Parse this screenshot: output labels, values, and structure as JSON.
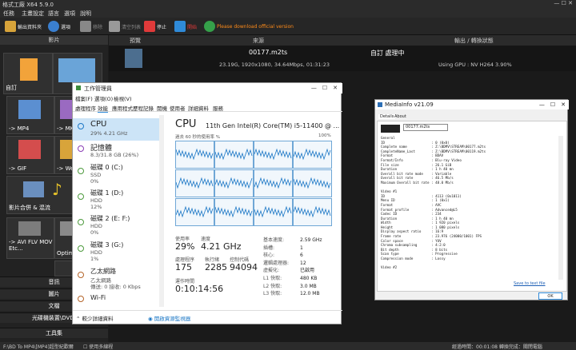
{
  "app": {
    "title": "格式工廠 X64 5.9.0"
  },
  "menu": [
    "任務",
    "主畫設定",
    "語言",
    "選項",
    "說明"
  ],
  "toolbar": {
    "output": "輸出資料夾",
    "options": "選項",
    "remove": "移除",
    "clear": "清空列表",
    "stop": "停止",
    "start": "開始",
    "download": "Please download official version"
  },
  "left": {
    "header": "影片",
    "tiles": [
      "自訂",
      "-> MP4",
      "-> MKV",
      "-> GIF",
      "-> Web",
      "影片合併 & 混流",
      "-> AVI FLV MOV Etc...",
      "Optimiz..."
    ],
    "bottom": [
      "音訊",
      "圖片",
      "文檔",
      "光碟機裝置\\DVD\\",
      "工具集"
    ]
  },
  "task": {
    "col_preview": "預覽",
    "col_source": "來源",
    "col_output": "輸出 / 轉換狀態",
    "filename": "00177.m2ts",
    "info": "23.19G, 1920x1080, 34.64Mbps, 01:31:23",
    "status": "自訂 處理中",
    "gpu": "Using GPU : NV H264 3.90%"
  },
  "status": {
    "left": "F:\\BD To MP4\\[MP4]超型紀歡爾",
    "checkbox": "使用多線程",
    "right": "經過時間：00:01:08  轉換完成：關閉電腦  "
  },
  "taskmgr": {
    "title": "工作管理員",
    "menu": [
      "檔案(F)",
      "選項(O)",
      "檢視(V)"
    ],
    "tabs": [
      "處理程序",
      "效能",
      "應用程式歷程記錄",
      "開機",
      "使用者",
      "詳細資料",
      "服務"
    ],
    "list": [
      {
        "name": "CPU",
        "sub": "29% 4.21 GHz"
      },
      {
        "name": "記憶體",
        "sub": "8.3/31.8 GB (26%)"
      },
      {
        "name": "磁碟 0 (C:)",
        "sub": "SSD",
        "sub2": "0%"
      },
      {
        "name": "磁碟 1 (D:)",
        "sub": "HDD",
        "sub2": "12%"
      },
      {
        "name": "磁碟 2 (E: F:)",
        "sub": "HDD",
        "sub2": "0%"
      },
      {
        "name": "磁碟 3 (G:)",
        "sub": "HDD",
        "sub2": "1%"
      },
      {
        "name": "乙太網路",
        "sub": "乙太網路",
        "sub2": "傳送: 0 接收: 0 Kbps"
      },
      {
        "name": "Wi-Fi",
        "sub": ""
      }
    ],
    "cpu_title": "CPU",
    "cpu_model": "11th Gen Intel(R) Core(TM) i5-11400 @ ...",
    "graph_label": "過去 60 秒的使用率 %",
    "graph_max": "100%",
    "util_label": "使用率",
    "util_val": "29%",
    "speed_label": "速度",
    "speed_val": "4.21 GHz",
    "proc_label": "處理程序",
    "proc_val": "175",
    "thread_label": "執行緒",
    "thread_val": "2285",
    "handle_label": "控制代碼",
    "handle_val": "94094",
    "uptime_label": "運作時間",
    "uptime_val": "0:10:14:56",
    "specs": [
      [
        "基本速度:",
        "2.59 GHz"
      ],
      [
        "插槽:",
        "1"
      ],
      [
        "核心:",
        "6"
      ],
      [
        "邏輯處理器:",
        "12"
      ],
      [
        "虛擬化:",
        "已啟用"
      ],
      [
        "L1 快取:",
        "480 KB"
      ],
      [
        "L2 快取:",
        "3.0 MB"
      ],
      [
        "L3 快取:",
        "12.0 MB"
      ]
    ],
    "less": "較少詳細資料",
    "resmon": "開啟資源監視器"
  },
  "mediainfo": {
    "title": "MediaInfo v21.09",
    "tabs": [
      "Details",
      "About"
    ],
    "file": "00177.m2ts",
    "lines": [
      "General",
      "ID                       : 0 (0x0)",
      "Complete name            : Z:\\BDMV\\STREAM\\00177.m2ts",
      "CompleteName_Last        : Z:\\BDMV\\STREAM\\00119.m2ts",
      "Format                   : BDAV",
      "Format/Info              : Blu-ray Video",
      "File size                : 26.1 GiB",
      "Duration                 : 1 h 40 mn",
      "Overall bit rate mode    : Variable",
      "Overall bit rate         : 46.5 Mb/s",
      "Maximum Overall bit rate : 48.0 Mb/s",
      "",
      "Video #1",
      "ID                       : 4113 (0x1011)",
      "Menu ID                  : 1 (0x1)",
      "Format                   : AVC",
      "Format profile           : Advanced@L5",
      "Codec ID                 : 234",
      "Duration                 : 1 h 40 mn",
      "Width                    : 1 920 pixels",
      "Height                   : 1 080 pixels",
      "Display aspect ratio     : 16:9",
      "Frame rate               : 23.976 (24000/1001) FPS",
      "Color space              : YUV",
      "Chroma subsampling       : 4:2:0",
      "Bit depth                : 8 bits",
      "Scan type                : Progressive",
      "Compression mode         : Lossy",
      "",
      "Video #2"
    ],
    "save": "Save to text file",
    "ok": "OK"
  },
  "colors": {
    "accent_blue": "#2f8ad8",
    "stop_red": "#e03a3a",
    "download_orange": "#ff8c1a",
    "graph_blue": "#1d78c6"
  }
}
